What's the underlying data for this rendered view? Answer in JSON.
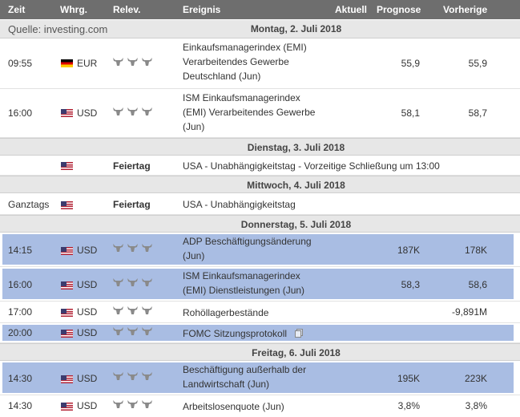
{
  "header": {
    "zeit": "Zeit",
    "whrg": "Whrg.",
    "relev": "Relev.",
    "ereignis": "Ereignis",
    "aktuell": "Aktuell",
    "prognose": "Prognose",
    "vorherige": "Vorherige"
  },
  "source": {
    "label": "Quelle: investing.com",
    "date": "Montag, 2. Juli 2018"
  },
  "days": [
    "Dienstag, 3. Juli 2018",
    "Mittwoch, 4. Juli 2018",
    "Donnerstag, 5. Juli 2018",
    "Freitag, 6. Juli 2018"
  ],
  "rows": [
    {
      "time": "09:55",
      "currency": "EUR",
      "flag": "de-flag-icon",
      "event_lines": [
        "Einkaufsmanagerindex (EMI)",
        "Verarbeitendes Gewerbe",
        "Deutschland (Jun)"
      ],
      "prognose": "55,9",
      "vorherige": "55,9"
    },
    {
      "time": "16:00",
      "currency": "USD",
      "flag": "us-flag-icon",
      "event_lines": [
        "ISM Einkaufsmanagerindex",
        "(EMI) Verarbeitendes Gewerbe",
        "(Jun)"
      ],
      "prognose": "58,1",
      "vorherige": "58,7"
    },
    {
      "time": "",
      "currency": "",
      "flag": "us-flag-icon",
      "relev_text": "Feiertag",
      "event_lines": [
        "USA - Unabhängigkeitstag - Vorzeitige Schließung um 13:00"
      ]
    },
    {
      "time": "Ganztags",
      "currency": "",
      "flag": "us-flag-icon",
      "relev_text": "Feiertag",
      "event_lines": [
        "USA - Unabhängigkeitstag"
      ]
    },
    {
      "time": "14:15",
      "currency": "USD",
      "flag": "us-flag-icon",
      "event_lines": [
        "ADP Beschäftigungsänderung",
        "(Jun)"
      ],
      "prognose": "187K",
      "vorherige": "178K"
    },
    {
      "time": "16:00",
      "currency": "USD",
      "flag": "us-flag-icon",
      "event_lines": [
        "ISM Einkaufsmanagerindex",
        "(EMI) Dienstleistungen (Jun)"
      ],
      "prognose": "58,3",
      "vorherige": "58,6"
    },
    {
      "time": "17:00",
      "currency": "USD",
      "flag": "us-flag-icon",
      "event_lines": [
        "Rohöllagerbestände"
      ],
      "prognose": "",
      "vorherige": "-9,891M"
    },
    {
      "time": "20:00",
      "currency": "USD",
      "flag": "us-flag-icon",
      "event_lines": [
        "FOMC Sitzungsprotokoll"
      ],
      "prognose": "",
      "vorherige": ""
    },
    {
      "time": "14:30",
      "currency": "USD",
      "flag": "us-flag-icon",
      "event_lines": [
        "Beschäftigung außerhalb der",
        "Landwirtschaft (Jun)"
      ],
      "prognose": "195K",
      "vorherige": "223K"
    },
    {
      "time": "14:30",
      "currency": "USD",
      "flag": "us-flag-icon",
      "event_lines": [
        "Arbeitslosenquote (Jun)"
      ],
      "prognose": "3,8%",
      "vorherige": "3,8%"
    }
  ],
  "colors": {
    "header_bg": "#6e6e6e",
    "day_bg": "#e7e7e7",
    "highlight": "#a9bde3"
  }
}
